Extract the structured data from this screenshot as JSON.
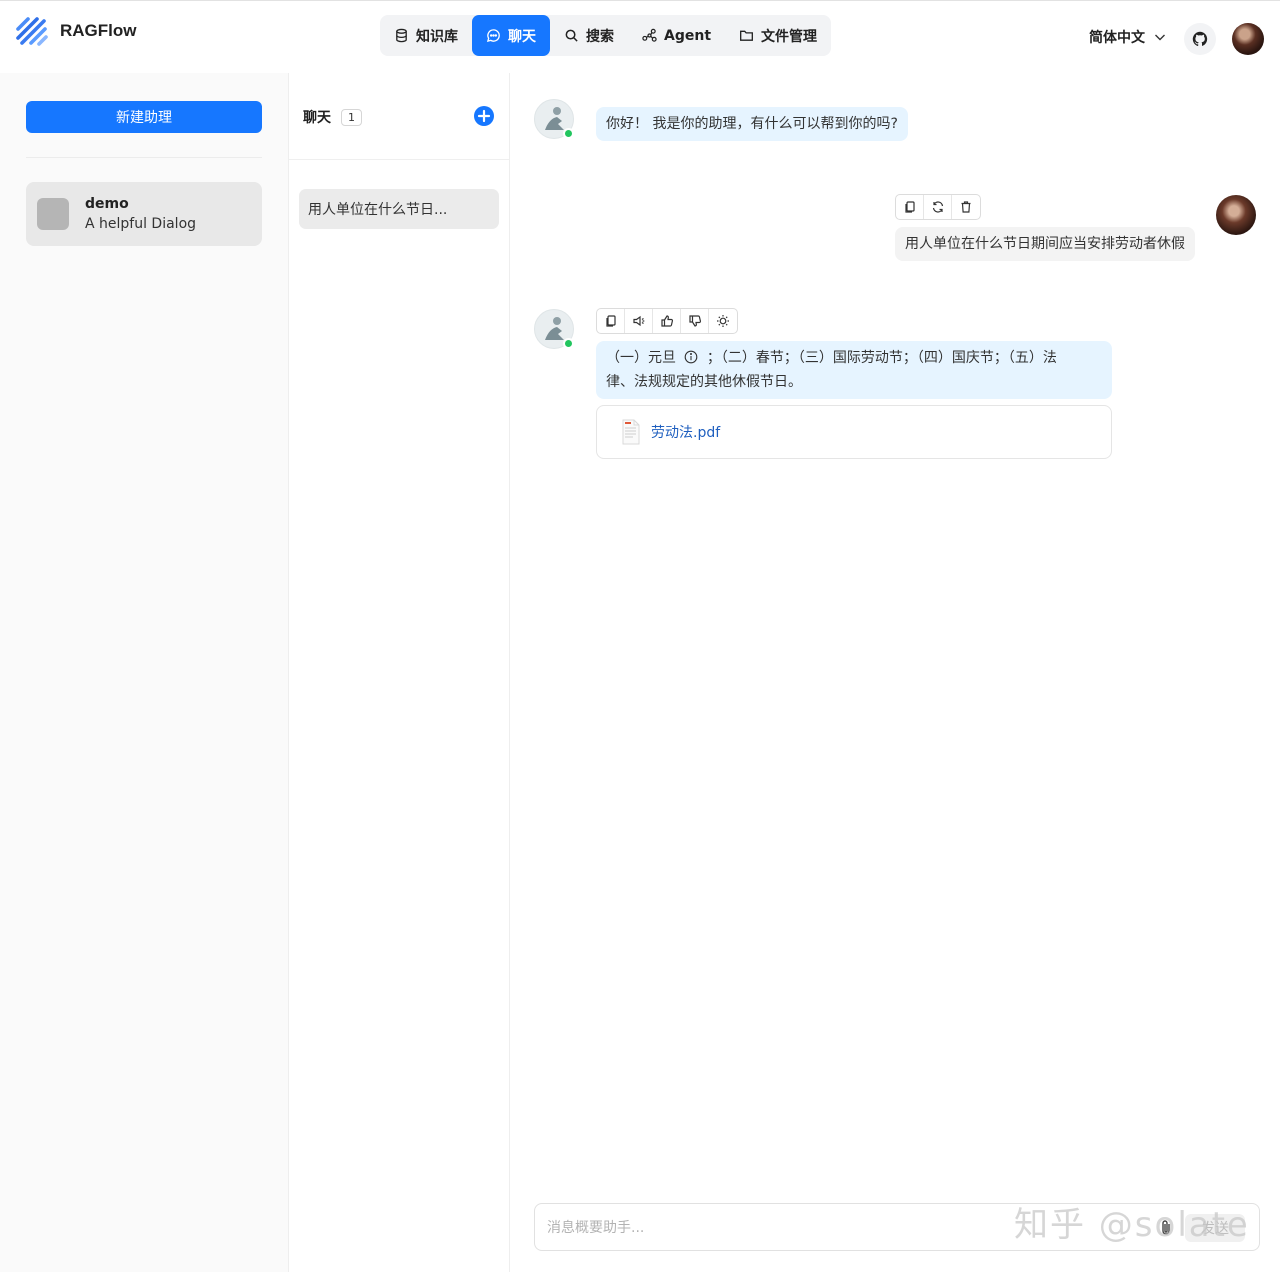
{
  "header": {
    "app_name": "RAGFlow",
    "nav": [
      {
        "label": "知识库",
        "icon": "database-icon"
      },
      {
        "label": "聊天",
        "icon": "chat-icon",
        "active": true
      },
      {
        "label": "搜索",
        "icon": "search-icon"
      },
      {
        "label": "Agent",
        "icon": "agent-graph-icon"
      },
      {
        "label": "文件管理",
        "icon": "folder-icon"
      }
    ],
    "language": "简体中文",
    "accent_color": "#1677ff"
  },
  "sidebar": {
    "new_button_label": "新建助理",
    "assistants": [
      {
        "name": "demo",
        "description": "A helpful Dialog"
      }
    ]
  },
  "conversations": {
    "title": "聊天",
    "count": "1",
    "items": [
      {
        "label": "用人单位在什么节日..."
      }
    ]
  },
  "chat": {
    "greeting": "你好！ 我是你的助理，有什么可以帮到你的吗?",
    "user_message": "用人单位在什么节日期间应当安排劳动者休假",
    "answer_line1_a": "（一）元旦",
    "answer_line1_b": "；（二）春节；（三）国际劳动节；（四）国庆节；（五）法",
    "answer_line2": "律、法规规定的其他休假节日。",
    "reference_file": "劳动法.pdf",
    "input_placeholder": "消息概要助手...",
    "send_label": "发送"
  },
  "watermark": "知乎 @solate"
}
